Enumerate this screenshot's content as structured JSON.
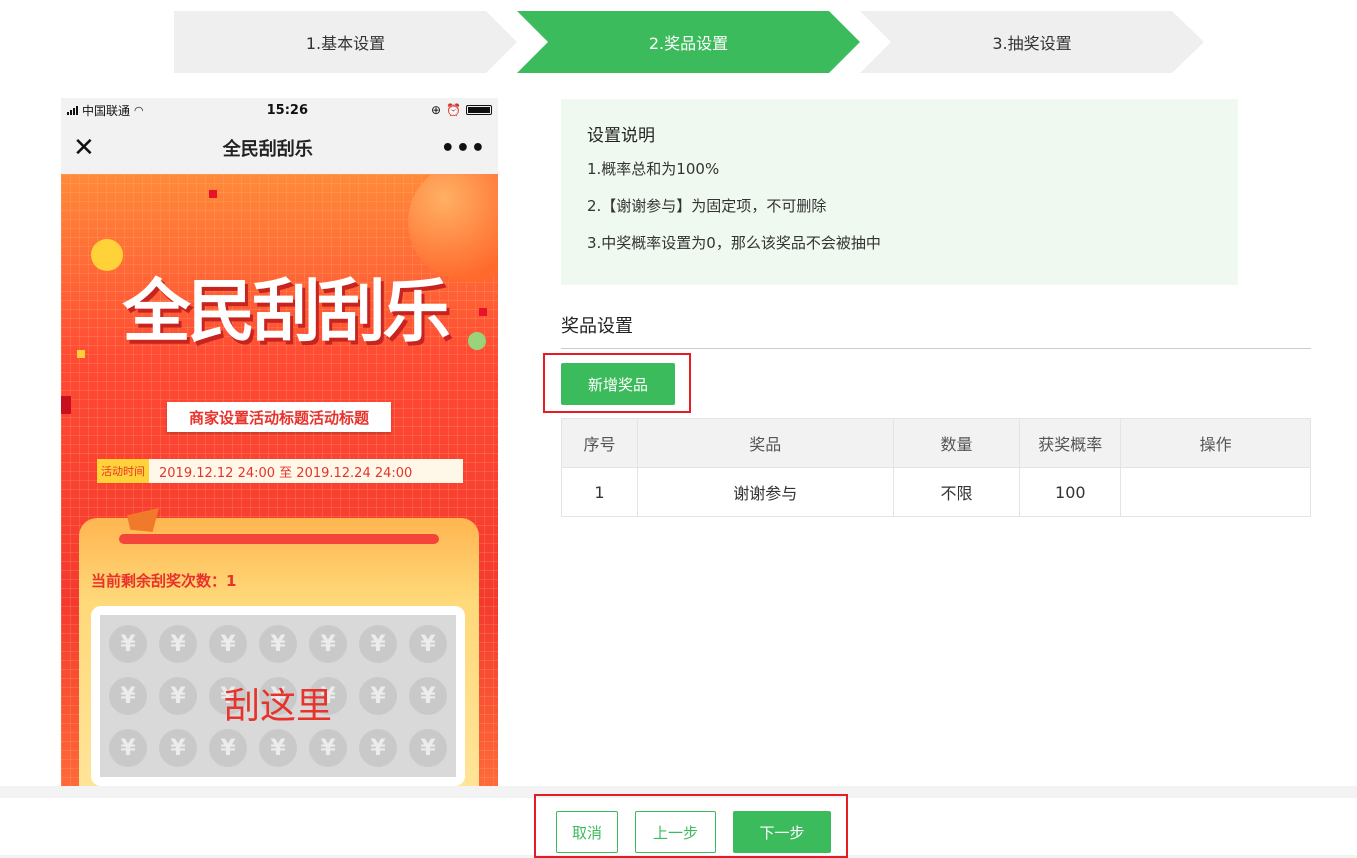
{
  "steps": [
    {
      "label": "1.基本设置",
      "active": false
    },
    {
      "label": "2.奖品设置",
      "active": true
    },
    {
      "label": "3.抽奖设置",
      "active": false
    }
  ],
  "phone": {
    "status": {
      "carrier": "中国联通",
      "time": "15:26"
    },
    "nav": {
      "close": "✕",
      "title": "全民刮刮乐",
      "more": "•••"
    },
    "poster": {
      "big_title": "全民刮刮乐",
      "activity_title": "商家设置活动标题活动标题",
      "time_label": "活动时间",
      "time_range": "2019.12.12 24:00 至 2019.12.24 24:00",
      "remaining": "当前剩余刮奖次数：1",
      "scratch_text": "刮这里",
      "coin_symbol": "¥"
    }
  },
  "info": {
    "title": "设置说明",
    "lines": [
      "1.概率总和为100%",
      "2.【谢谢参与】为固定项，不可删除",
      "3.中奖概率设置为0，那么该奖品不会被抽中"
    ]
  },
  "prize_section": {
    "title": "奖品设置",
    "add_button": "新增奖品",
    "columns": [
      "序号",
      "奖品",
      "数量",
      "获奖概率",
      "操作"
    ],
    "rows": [
      [
        "1",
        "谢谢参与",
        "不限",
        "100",
        ""
      ]
    ]
  },
  "footer": {
    "cancel": "取消",
    "prev": "上一步",
    "next": "下一步"
  },
  "colors": {
    "accent": "#3cbb5c",
    "highlight": "#e51c23",
    "poster_red": "#f43a2f"
  }
}
